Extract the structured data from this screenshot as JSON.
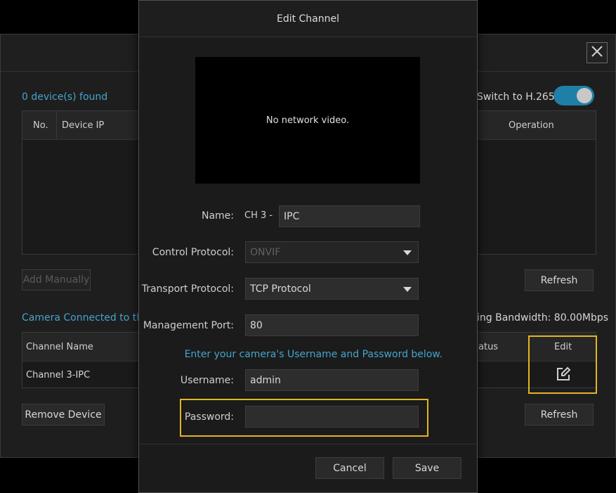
{
  "background": {
    "devices_found": "0 device(s) found",
    "switch_label": "Switch to H.265",
    "device_table": {
      "col_no": "No.",
      "col_device_ip": "Device IP",
      "col_operation": "Operation"
    },
    "add_manually": "Add Manually",
    "refresh_top": "Refresh",
    "camera_connected": "Camera Connected to the",
    "bandwidth": "ing Bandwidth: 80.00Mbps",
    "channel_table": {
      "col_channel_name": "Channel Name",
      "col_status": "atus",
      "col_edit": "Edit",
      "row_channel": "Channel 3-IPC"
    },
    "remove_device": "Remove Device",
    "refresh_bottom": "Refresh"
  },
  "modal": {
    "title": "Edit Channel",
    "video_text": "No network video.",
    "name_label": "Name:",
    "name_prefix": "CH 3 -",
    "name_value": "IPC",
    "control_protocol_label": "Control Protocol:",
    "control_protocol_value": "ONVIF",
    "transport_protocol_label": "Transport Protocol:",
    "transport_protocol_value": "TCP Protocol",
    "management_port_label": "Management Port:",
    "management_port_value": "80",
    "hint": "Enter your camera's Username and Password below.",
    "username_label": "Username:",
    "username_value": "admin",
    "password_label": "Password:",
    "password_value": "",
    "cancel": "Cancel",
    "save": "Save"
  },
  "colors": {
    "accent_blue": "#45a4cc",
    "highlight_yellow": "#e3b520",
    "toggle_on": "#1f7fa6"
  }
}
